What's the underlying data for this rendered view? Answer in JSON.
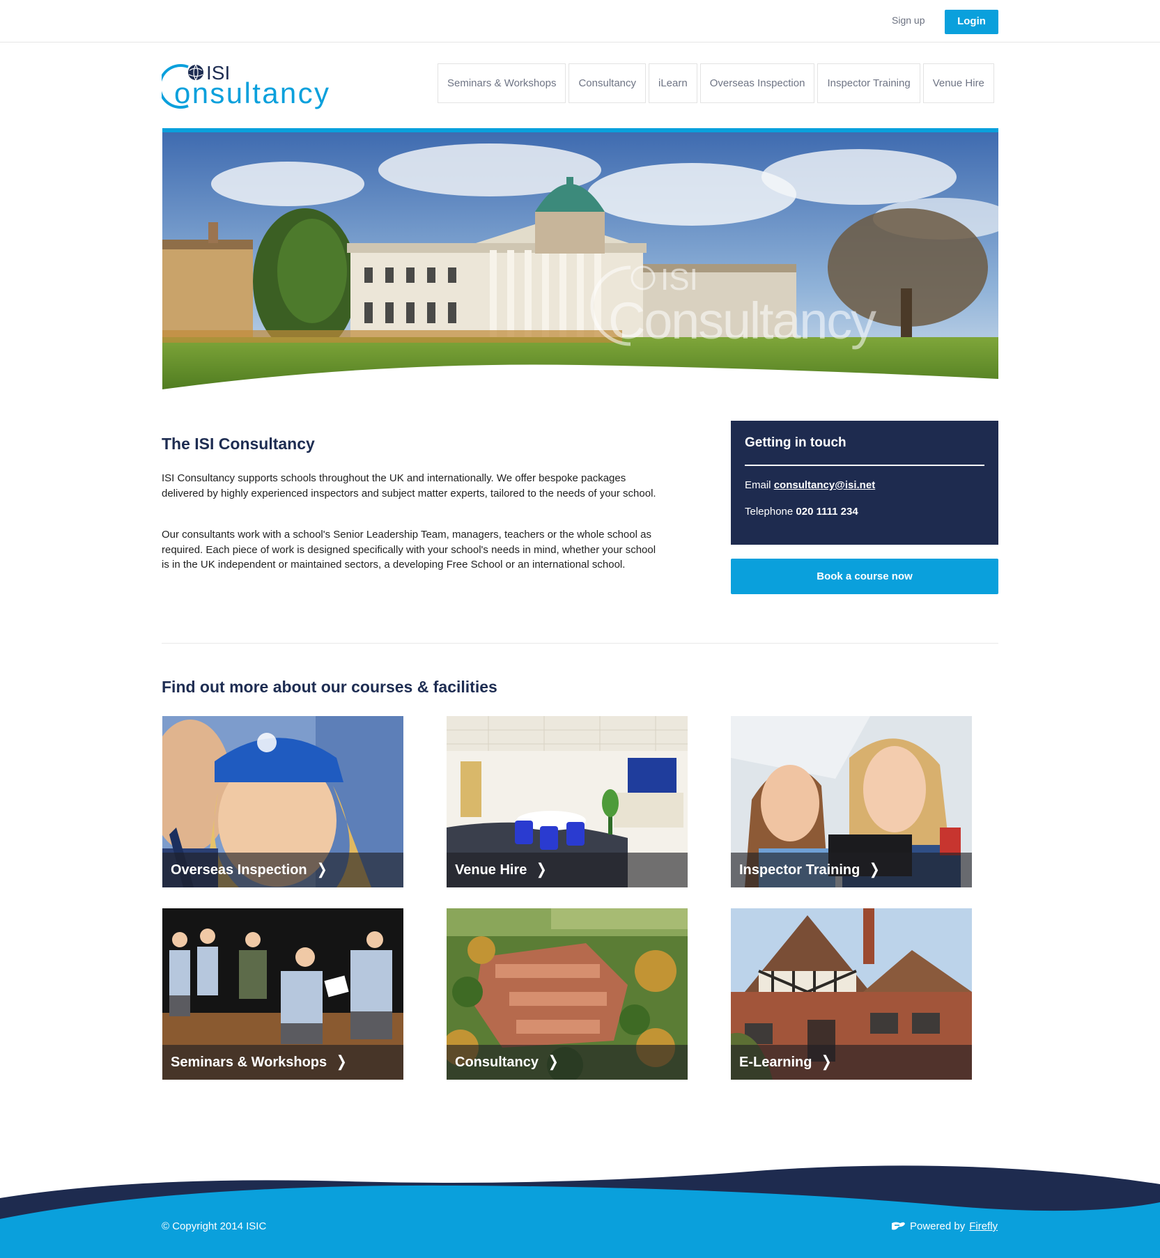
{
  "header": {
    "signup_label": "Sign up",
    "login_label": "Login"
  },
  "logo": {
    "line1": "ISI",
    "line2": "Consultancy",
    "color": "#0aa0dc",
    "globe_color": "#1e2d52"
  },
  "nav": {
    "items": [
      {
        "label": "Seminars & Workshops"
      },
      {
        "label": "Consultancy"
      },
      {
        "label": "iLearn"
      },
      {
        "label": "Overseas Inspection"
      },
      {
        "label": "Inspector Training"
      },
      {
        "label": "Venue Hire"
      }
    ]
  },
  "hero": {
    "watermark_line1": "ISI",
    "watermark_line2": "Consultancy"
  },
  "intro": {
    "title": "The ISI Consultancy",
    "paragraph1": "ISI Consultancy supports schools throughout the UK and internationally. We offer bespoke packages delivered by highly experienced inspectors and subject matter experts, tailored to the needs of your school.",
    "paragraph2": "Our consultants work with a school's Senior Leadership Team, managers, teachers or the whole school as required. Each piece of work is designed specifically with your school's needs in mind, whether your school is in the UK independent or maintained sectors, a developing Free School or an international school."
  },
  "contact": {
    "title": "Getting in touch",
    "email_label": "Email",
    "email": "consultancy@isi.net",
    "phone_label": "Telephone",
    "phone": "020 1111 234",
    "book_label": "Book a course now"
  },
  "courses": {
    "title": "Find out more about our courses & facilities",
    "tiles": [
      {
        "label": "Overseas Inspection"
      },
      {
        "label": "Venue Hire"
      },
      {
        "label": "Inspector Training"
      },
      {
        "label": "Seminars & Workshops"
      },
      {
        "label": "Consultancy"
      },
      {
        "label": "E-Learning"
      }
    ],
    "chevron": "❯"
  },
  "footer": {
    "copyright": "© Copyright 2014 ISIC",
    "powered_by": "Powered by",
    "powered_link": "Firefly"
  },
  "colors": {
    "accent": "#0aa0dc",
    "navy": "#1e2b4f"
  }
}
